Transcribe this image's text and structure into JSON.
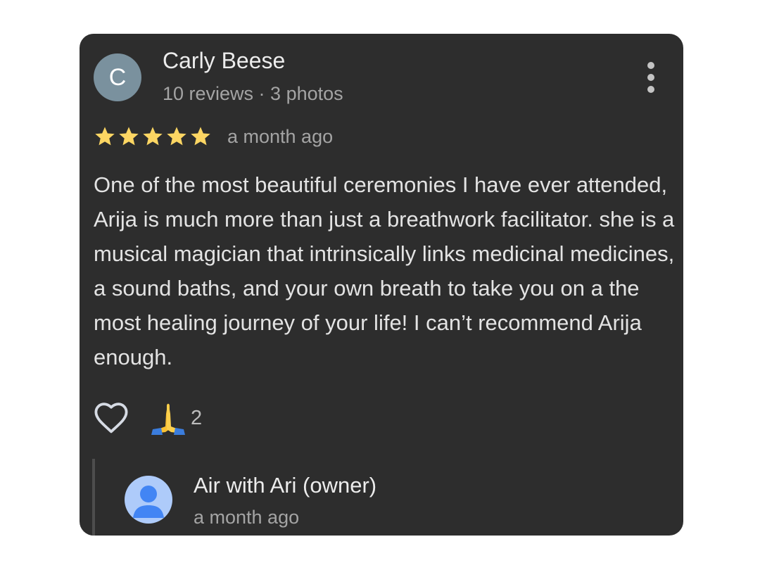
{
  "review": {
    "avatar_initial": "C",
    "reviewer_name": "Carly Beese",
    "reviewer_meta": "10 reviews · 3 photos",
    "rating": 5,
    "date": "a month ago",
    "text": "One of the most beautiful ceremonies I have ever attended, Arija is much more than just a breathwork facilitator. she is a musical magician that intrinsically links medicinal medicines, a sound baths, and your own breath to take you on a the most healing journey of your life! I can’t recommend Arija enough.",
    "more_icon": "more-vert-icon",
    "star_icon": "star-icon"
  },
  "reactions": {
    "like_icon": "heart-outline-icon",
    "reaction_icon": "folded-hands-icon",
    "count": "2"
  },
  "owner_reply": {
    "name": "Air with Ari (owner)",
    "date": "a month ago",
    "avatar_icon": "person-avatar-icon"
  },
  "colors": {
    "card_background": "#2d2d2d",
    "star": "#fdd663",
    "avatar_background": "#7a919e",
    "owner_avatar_background": "#aecbfa",
    "owner_avatar_figure": "#4285f4"
  }
}
